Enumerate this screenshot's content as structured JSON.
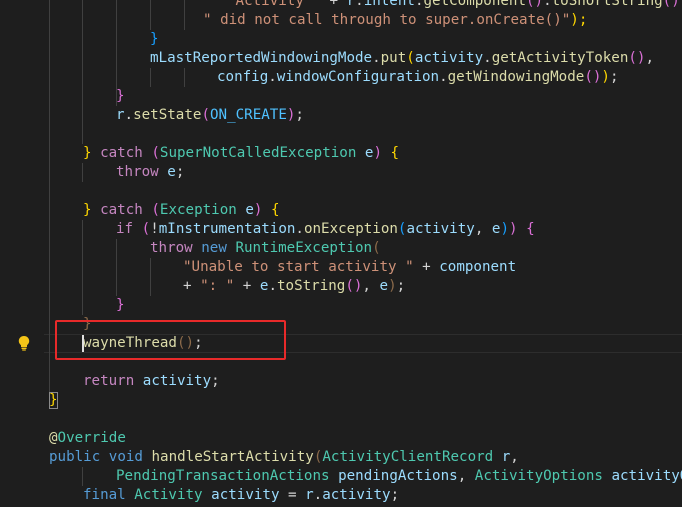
{
  "editor": {
    "language": "java",
    "lightbulb_icon": "lightbulb-icon",
    "colors": {
      "background": "#1e1e1e",
      "keyword": "#569cd6",
      "control": "#c586c0",
      "function": "#dcdcaa",
      "variable": "#9cdcfe",
      "type": "#4ec9b0",
      "string": "#ce9178",
      "constant": "#4fc1ff",
      "highlight_box": "#e82a2a"
    }
  },
  "code": {
    "l0": {
      "t1": "\"Activity \"",
      "t2": " + ",
      "t3": "r",
      "t4": ".",
      "t5": "intent",
      "t6": ".",
      "t7": "getComponent",
      "t8": "()",
      "t9": ".",
      "t10": "toShortString",
      "t11": "()",
      "t12": " +"
    },
    "l1": {
      "t1": "\" did not call through to super.onCreate()\"",
      "t2": ");"
    },
    "l2": {
      "t1": "}"
    },
    "l3": {
      "t1": "mLastReportedWindowingMode",
      "t2": ".",
      "t3": "put",
      "t4": "(",
      "t5": "activity",
      "t6": ".",
      "t7": "getActivityToken",
      "t8": "()",
      "t9": ","
    },
    "l4": {
      "t1": "config",
      "t2": ".",
      "t3": "windowConfiguration",
      "t4": ".",
      "t5": "getWindowingMode",
      "t6": "()",
      "t7": ")",
      "t8": ";"
    },
    "l5": {
      "t1": "}"
    },
    "l6": {
      "t1": "r",
      "t2": ".",
      "t3": "setState",
      "t4": "(",
      "t5": "ON_CREATE",
      "t6": ")",
      "t7": ";"
    },
    "l8": {
      "t1": "} ",
      "t2": "catch",
      "t3": " (",
      "t4": "SuperNotCalledException",
      "t5": " ",
      "t6": "e",
      "t7": ")",
      "t8": " {"
    },
    "l9": {
      "t1": "throw",
      "t2": " ",
      "t3": "e",
      "t4": ";"
    },
    "l11": {
      "t1": "} ",
      "t2": "catch",
      "t3": " (",
      "t4": "Exception",
      "t5": " ",
      "t6": "e",
      "t7": ")",
      "t8": " {"
    },
    "l12": {
      "t1": "if",
      "t2": " (",
      "t3": "!",
      "t4": "mInstrumentation",
      "t5": ".",
      "t6": "onException",
      "t7": "(",
      "t8": "activity",
      "t9": ", ",
      "t10": "e",
      "t11": ")",
      "t12": ")",
      "t13": " {"
    },
    "l13": {
      "t1": "throw",
      "t2": " ",
      "t3": "new",
      "t4": " ",
      "t5": "RuntimeException",
      "t6": "("
    },
    "l14": {
      "t1": "\"Unable to start activity \"",
      "t2": " + ",
      "t3": "component"
    },
    "l15": {
      "t1": "+ ",
      "t2": "\": \"",
      "t3": " + ",
      "t4": "e",
      "t5": ".",
      "t6": "toString",
      "t7": "()",
      "t8": ", ",
      "t9": "e",
      "t10": ")",
      "t11": ";"
    },
    "l16": {
      "t1": "}"
    },
    "l17": {
      "t1": "}"
    },
    "l18": {
      "t1": "wayneThread",
      "t2": "()",
      "t3": ";"
    },
    "l20": {
      "t1": "return",
      "t2": " ",
      "t3": "activity",
      "t4": ";"
    },
    "l21": {
      "t1": "}"
    },
    "l23": {
      "t1": "@",
      "t2": "Override"
    },
    "l24": {
      "t1": "public",
      "t2": " ",
      "t3": "void",
      "t4": " ",
      "t5": "handleStartActivity",
      "t6": "(",
      "t7": "ActivityClientRecord",
      "t8": " ",
      "t9": "r",
      "t10": ","
    },
    "l25": {
      "t1": "PendingTransactionActions",
      "t2": " ",
      "t3": "pendingActions",
      "t4": ", ",
      "t5": "ActivityOptions",
      "t6": " ",
      "t7": "activityO"
    },
    "l26": {
      "t1": "final",
      "t2": " ",
      "t3": "Activity",
      "t4": " ",
      "t5": "activity",
      "t6": " = ",
      "t7": "r",
      "t8": ".",
      "t9": "activity",
      "t10": ";"
    }
  }
}
